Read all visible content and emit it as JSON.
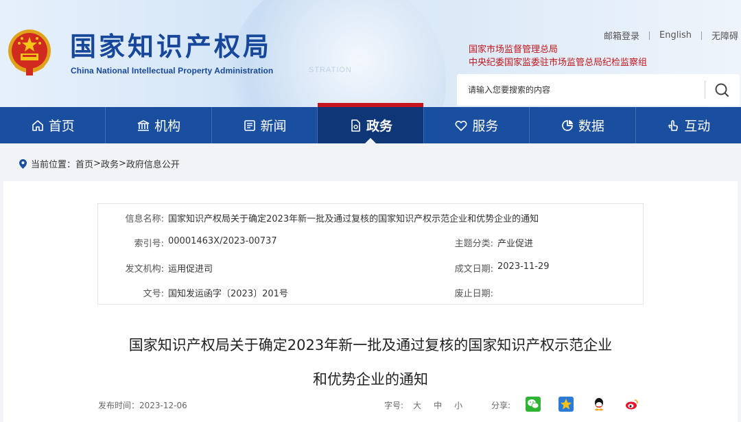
{
  "header": {
    "title": "国家知识产权局",
    "subtitle": "China National Intellectual Property Administration",
    "watermark": "STRATION",
    "links": [
      "邮箱登录",
      "English",
      "无障碍"
    ],
    "dept_1": "国家市场监督管理总局",
    "dept_2": "中央纪委国家监委驻市场监管总局纪检监察组",
    "search_placeholder": "请输入您要搜索的内容"
  },
  "nav": {
    "items": [
      {
        "label": "首页",
        "icon": "home-icon"
      },
      {
        "label": "机构",
        "icon": "institution-icon"
      },
      {
        "label": "新闻",
        "icon": "news-icon"
      },
      {
        "label": "政务",
        "icon": "government-icon"
      },
      {
        "label": "服务",
        "icon": "service-icon"
      },
      {
        "label": "数据",
        "icon": "data-icon"
      },
      {
        "label": "互动",
        "icon": "interact-icon"
      }
    ],
    "active_index": 3,
    "color": "#1a4fa0",
    "active_color": "#0f3676",
    "accent": "#c4161c"
  },
  "breadcrumb": {
    "prefix": "当前位置：",
    "items": [
      "首页",
      "政务",
      "政府信息公开"
    ],
    "separator": ">"
  },
  "info": {
    "name_label": "信息名称:",
    "name_value": "国家知识产权局关于确定2023年新一批及通过复核的国家知识产权示范企业和优势企业的通知",
    "index_label": "索引号:",
    "index_value": "00001463X/2023-00737",
    "topic_label": "主题分类:",
    "topic_value": "产业促进",
    "issuer_label": "发文机构:",
    "issuer_value": "运用促进司",
    "date_label": "成文日期:",
    "date_value": "2023-11-29",
    "docno_label": "文号:",
    "docno_value": "国知发运函字〔2023〕201号",
    "abolish_label": "废止日期:",
    "abolish_value": ""
  },
  "document": {
    "title_line1": "国家知识产权局关于确定2023年新一批及通过复核的国家知识产权示范企业",
    "title_line2": "和优势企业的通知",
    "publish_label": "发布时间：",
    "publish_date": "2023-12-06",
    "fontsize_label": "字号:",
    "fontsize_options": [
      "大",
      "中",
      "小"
    ],
    "share_label": "分享:",
    "share_targets": [
      "wechat-icon",
      "qzone-icon",
      "qq-icon",
      "weibo-icon"
    ]
  }
}
